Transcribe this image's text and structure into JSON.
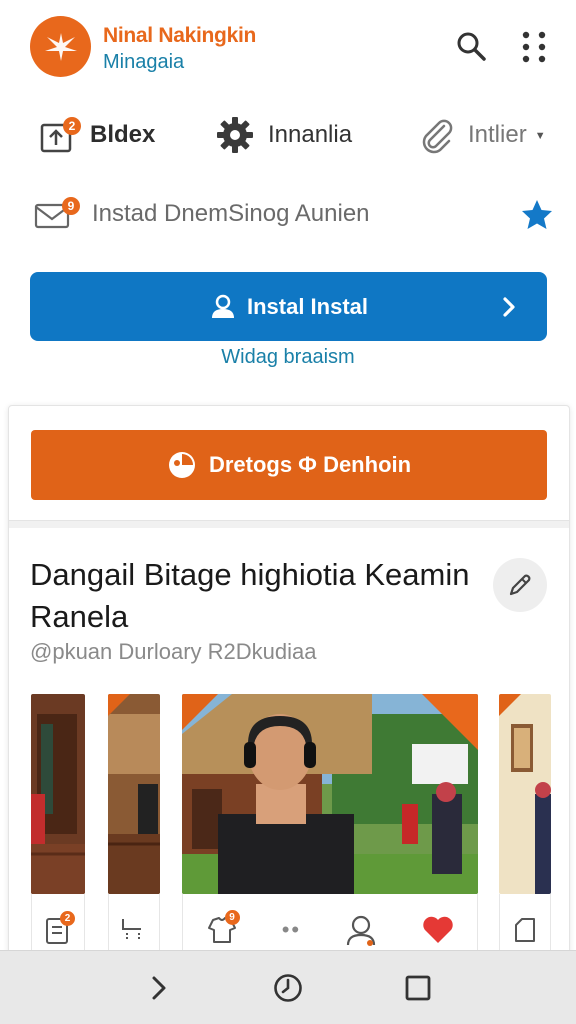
{
  "header": {
    "title": "Ninal Nakingkin",
    "subtitle": "Minagaia",
    "logo_icon": "bird-logo-icon",
    "brand_color": "#e8681c"
  },
  "categories": [
    {
      "label": "Bldex",
      "icon": "upload-box-icon",
      "badge": "2"
    },
    {
      "label": "Innanlia",
      "icon": "gear-icon"
    },
    {
      "label": "Intlier",
      "icon": "paperclip-icon",
      "has_dropdown": true
    }
  ],
  "install_row": {
    "label": "Instad DnemSinog Aunien",
    "icon": "mail-icon",
    "badge": "9",
    "star_icon": "star-icon"
  },
  "primary_button": {
    "label": "Instal Instal",
    "color": "#0f77c4"
  },
  "secondary_link": "Widag braaism",
  "card": {
    "action_button": "Dretogs Ф Denhoin",
    "action_color": "#e06318",
    "title": "Dangail Bitage highiotia Keamin Ranela",
    "subtitle": "@pkuan Durloary R2Dkudiaa"
  },
  "gallery_badges": {
    "item1": "2",
    "item3": "9"
  },
  "bottom_nav": {
    "items": [
      "back-icon",
      "history-icon",
      "recents-icon"
    ]
  }
}
